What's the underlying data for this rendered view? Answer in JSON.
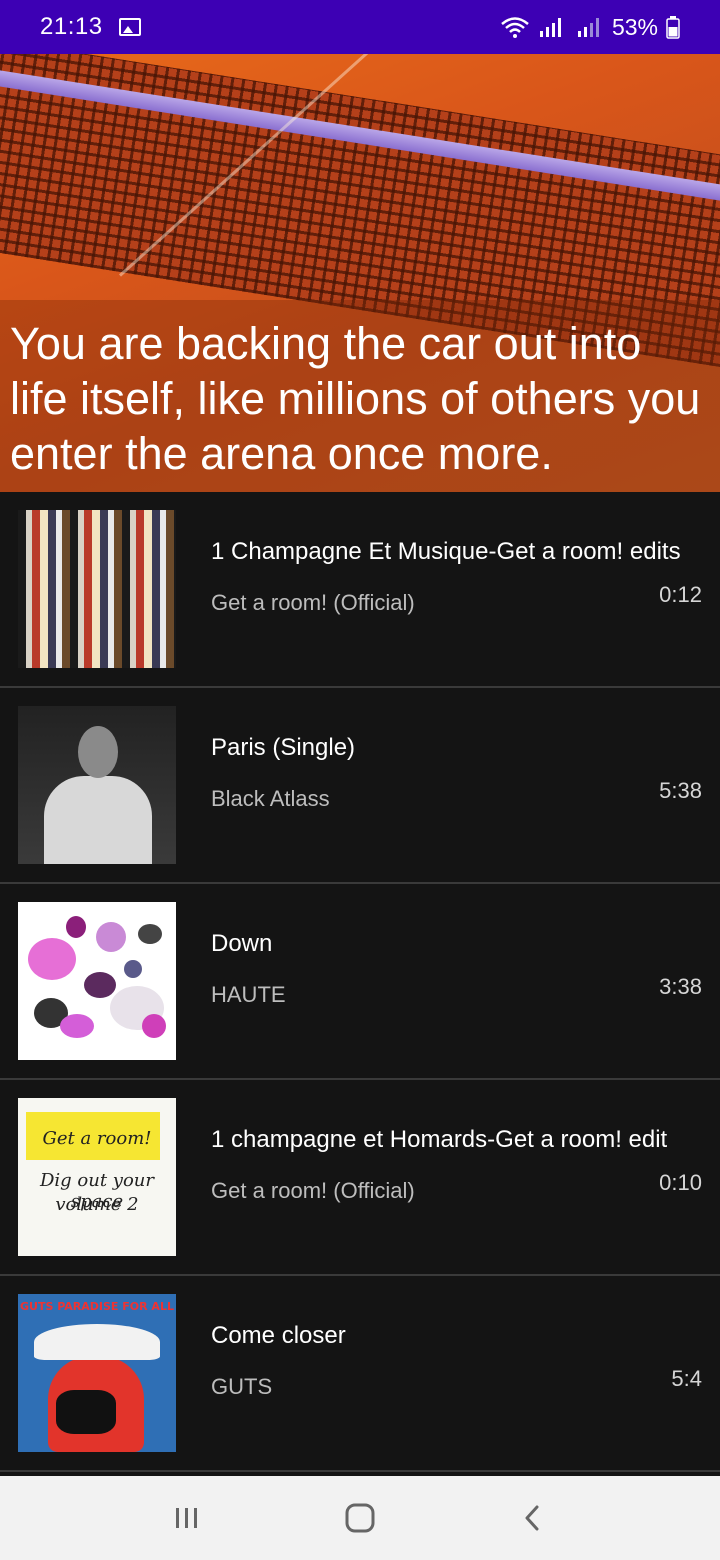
{
  "status_bar": {
    "time": "21:13",
    "battery": "53%",
    "background_color": "#3d00b4"
  },
  "hero": {
    "caption": "You are backing the car out into life itself, like millions of others you enter the arena once more."
  },
  "tracks": [
    {
      "title": "1 Champagne Et Musique-Get a room! edits",
      "artist": "Get a room! (Official)",
      "duration": "0:12"
    },
    {
      "title": "Paris (Single)",
      "artist": "Black Atlass",
      "duration": "5:38"
    },
    {
      "title": "Down",
      "artist": "HAUTE",
      "duration": "3:38"
    },
    {
      "title": "1 champagne et Homards-Get a room! edit",
      "artist": "Get a room! (Official)",
      "duration": "0:10"
    },
    {
      "title": "Come closer",
      "artist": "GUTS",
      "duration": "5:4"
    }
  ],
  "artwork_text": {
    "yellow_cover_line1": "Get a room!",
    "yellow_cover_line2": "Dig out your space",
    "yellow_cover_line3": "volume 2",
    "guts_cover_banner": "GUTS PARADISE FOR ALL"
  },
  "icons": {
    "status_image": "image-icon",
    "wifi": "wifi-icon",
    "signal": "signal-icon",
    "battery": "battery-icon",
    "nav_recents": "recents-icon",
    "nav_home": "home-icon",
    "nav_back": "back-icon"
  }
}
